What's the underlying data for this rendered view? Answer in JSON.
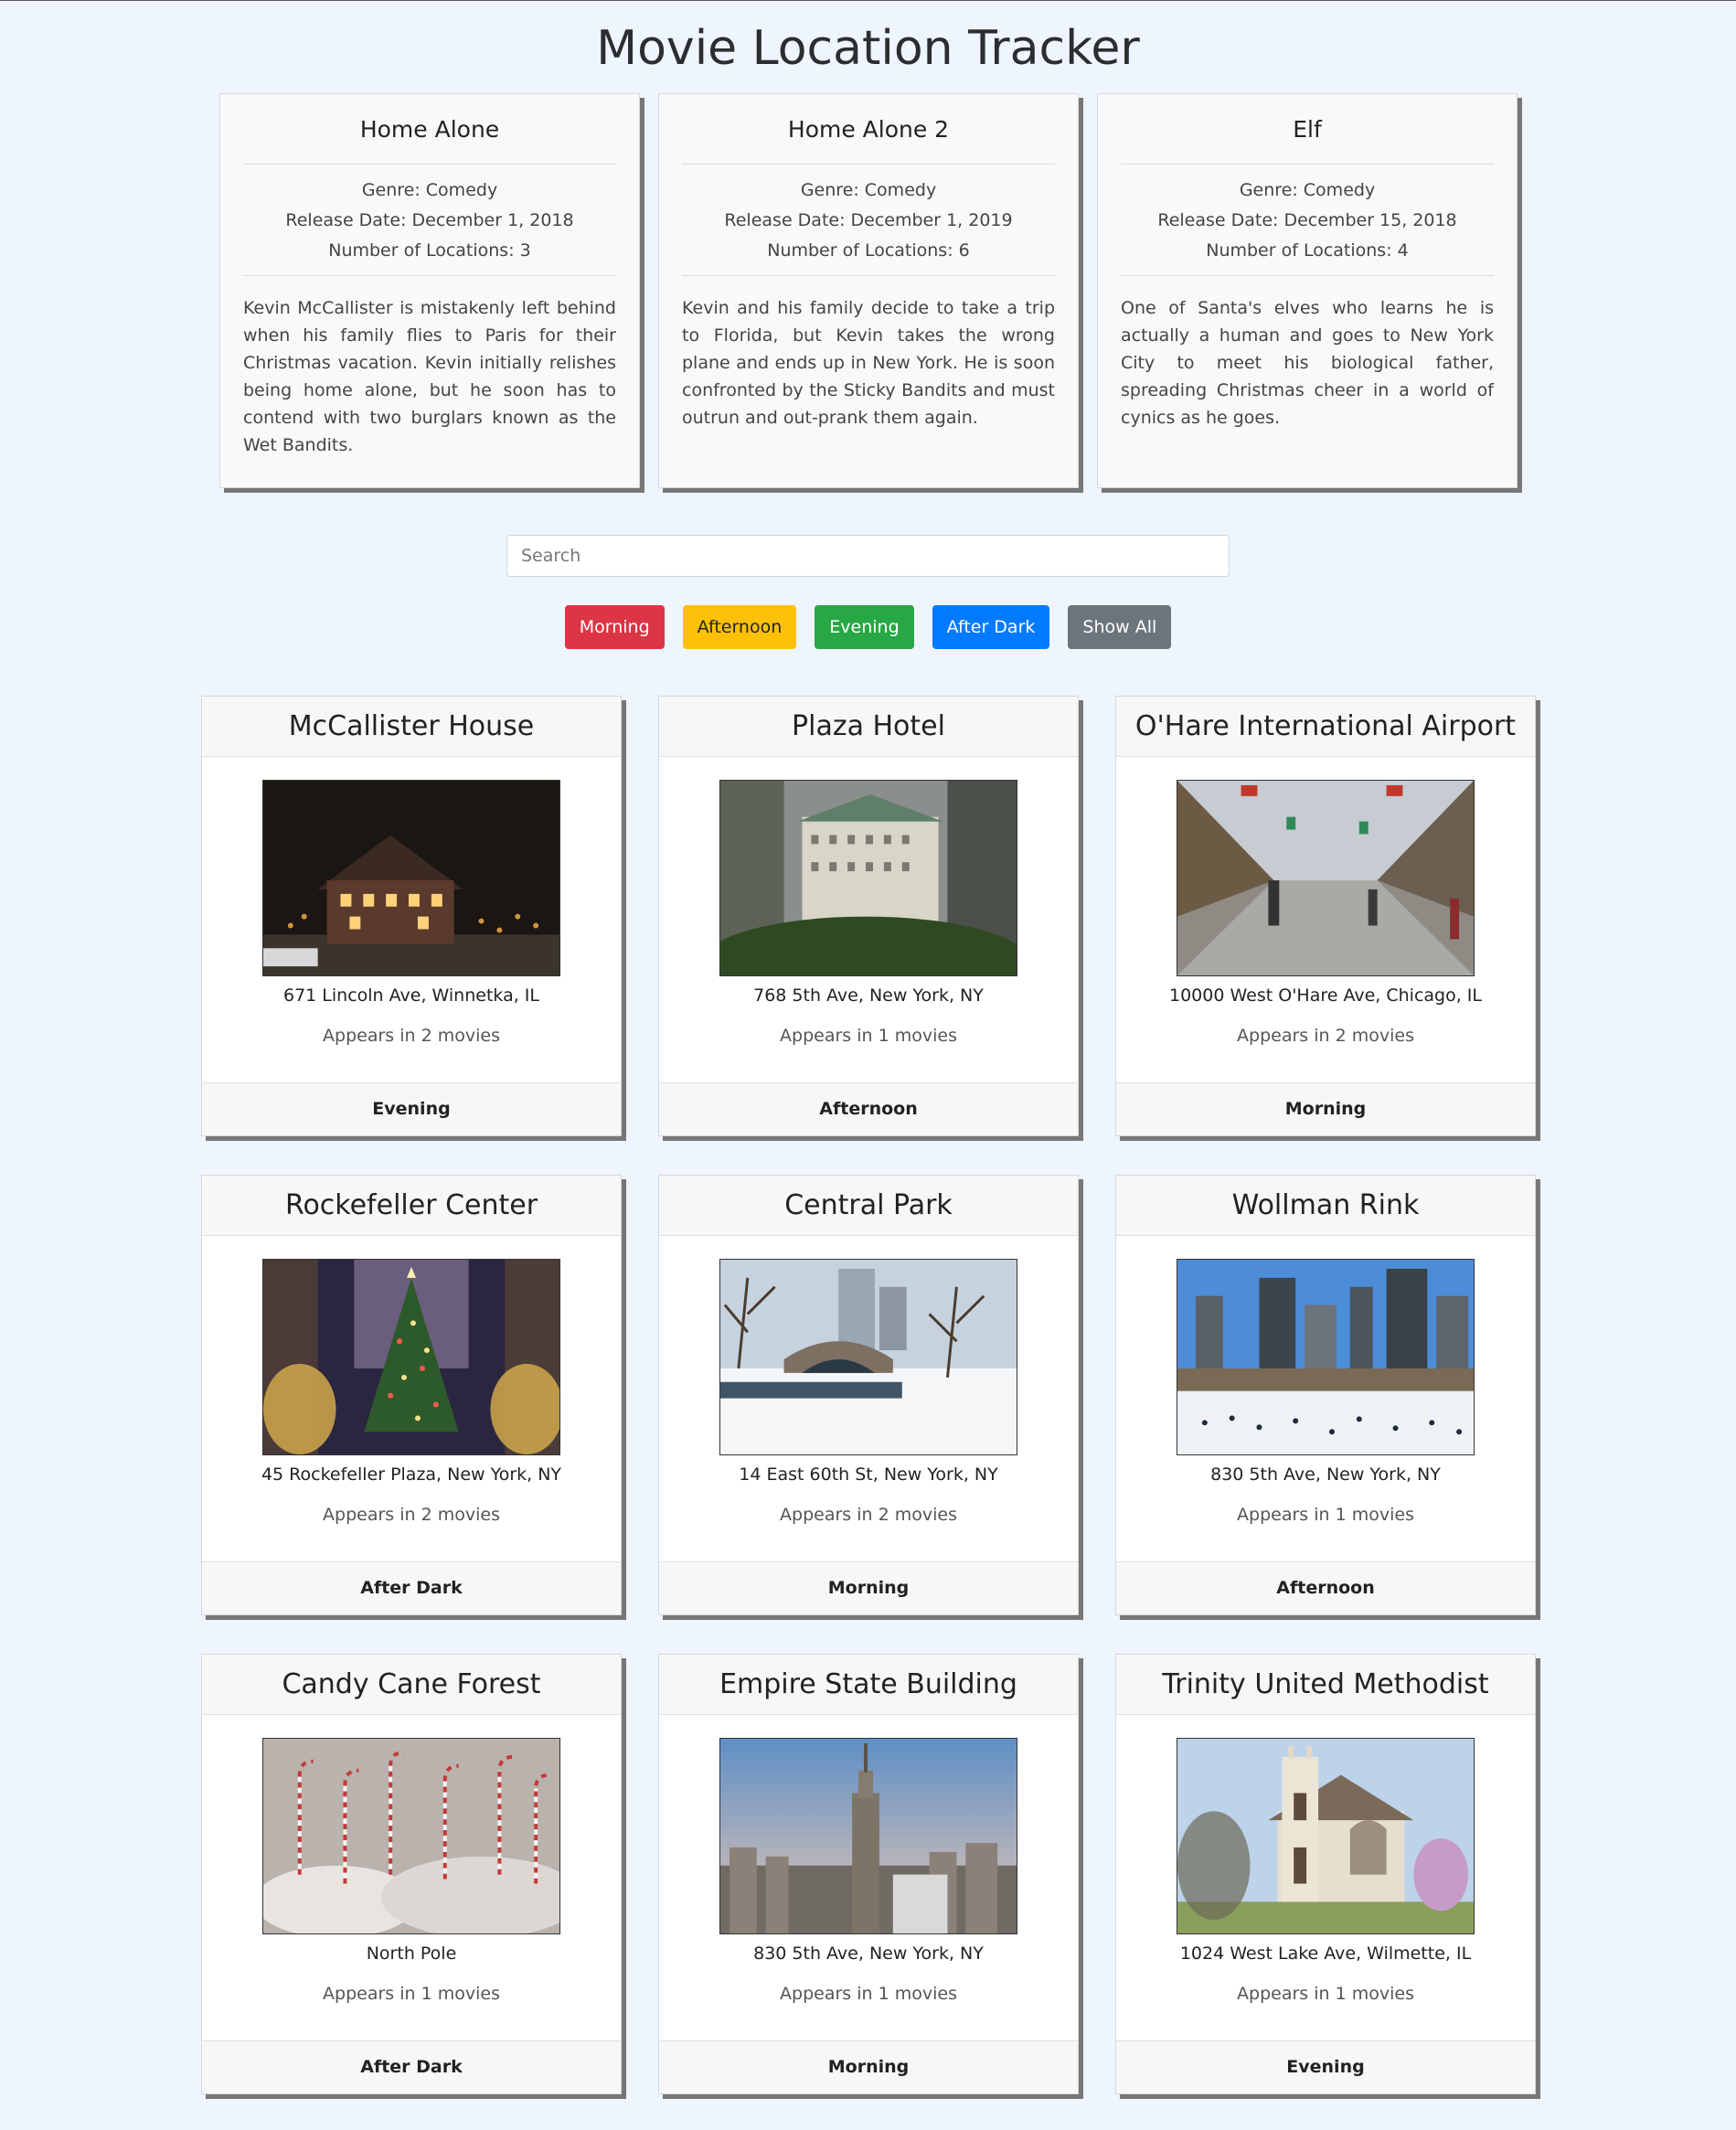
{
  "app": {
    "title": "Movie Location Tracker"
  },
  "movies": [
    {
      "title": "Home Alone",
      "genre": "Genre: Comedy",
      "release": "Release Date: December 1, 2018",
      "locations": "Number of Locations: 3",
      "description": "Kevin McCallister is mistakenly left behind when his family flies to Paris for their Christmas vacation. Kevin initially relishes being home alone, but he soon has to contend with two burglars known as the Wet Bandits."
    },
    {
      "title": "Home Alone 2",
      "genre": "Genre: Comedy",
      "release": "Release Date: December 1, 2019",
      "locations": "Number of Locations: 6",
      "description": "Kevin and his family decide to take a trip to Florida, but Kevin takes the wrong plane and ends up in New York. He is soon confronted by the Sticky Bandits and must outrun and out-prank them again."
    },
    {
      "title": "Elf",
      "genre": "Genre: Comedy",
      "release": "Release Date: December 15, 2018",
      "locations": "Number of Locations: 4",
      "description": "One of Santa's elves who learns he is actually a human and goes to New York City to meet his biological father, spreading Christmas cheer in a world of cynics as he goes."
    }
  ],
  "search": {
    "placeholder": "Search",
    "value": ""
  },
  "filters": [
    {
      "label": "Morning",
      "color": "#dc3545",
      "text_color": "#ffffff"
    },
    {
      "label": "Afternoon",
      "color": "#ffc107",
      "text_color": "#212529"
    },
    {
      "label": "Evening",
      "color": "#28a745",
      "text_color": "#ffffff"
    },
    {
      "label": "After Dark",
      "color": "#007bff",
      "text_color": "#ffffff"
    },
    {
      "label": "Show All",
      "color": "#6c757d",
      "text_color": "#ffffff"
    }
  ],
  "locations": [
    {
      "name": "McCallister House",
      "address": "671 Lincoln Ave, Winnetka, IL",
      "appears": "Appears in 2 movies",
      "time": "Evening",
      "image": "house-night-photo"
    },
    {
      "name": "Plaza Hotel",
      "address": "768 5th Ave, New York, NY",
      "appears": "Appears in 1 movies",
      "time": "Afternoon",
      "image": "hotel-photo"
    },
    {
      "name": "O'Hare International Airport",
      "address": "10000 West O'Hare Ave, Chicago, IL",
      "appears": "Appears in 2 movies",
      "time": "Morning",
      "image": "airport-photo"
    },
    {
      "name": "Rockefeller Center",
      "address": "45 Rockefeller Plaza, New York, NY",
      "appears": "Appears in 2 movies",
      "time": "After Dark",
      "image": "christmas-tree-photo"
    },
    {
      "name": "Central Park",
      "address": "14 East 60th St, New York, NY",
      "appears": "Appears in 2 movies",
      "time": "Morning",
      "image": "snowy-park-photo"
    },
    {
      "name": "Wollman Rink",
      "address": "830 5th Ave, New York, NY",
      "appears": "Appears in 1 movies",
      "time": "Afternoon",
      "image": "ice-rink-photo"
    },
    {
      "name": "Candy Cane Forest",
      "address": "North Pole",
      "appears": "Appears in 1 movies",
      "time": "After Dark",
      "image": "candy-cane-photo"
    },
    {
      "name": "Empire State Building",
      "address": "830 5th Ave, New York, NY",
      "appears": "Appears in 1 movies",
      "time": "Morning",
      "image": "skyscraper-photo"
    },
    {
      "name": "Trinity United Methodist",
      "address": "1024 West Lake Ave, Wilmette, IL",
      "appears": "Appears in 1 movies",
      "time": "Evening",
      "image": "church-photo"
    }
  ]
}
